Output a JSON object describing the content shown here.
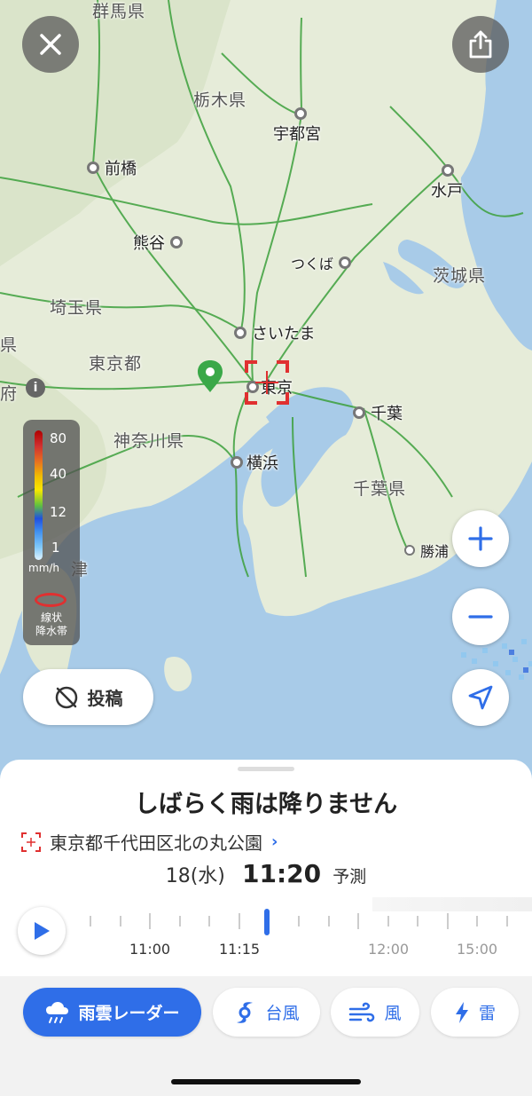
{
  "map": {
    "cities": [
      {
        "name": "宇都宮"
      },
      {
        "name": "前橋"
      },
      {
        "name": "水戸"
      },
      {
        "name": "熊谷"
      },
      {
        "name": "つくば"
      },
      {
        "name": "さいたま"
      },
      {
        "name": "東京"
      },
      {
        "name": "千葉"
      },
      {
        "name": "横浜"
      },
      {
        "name": "勝浦"
      }
    ],
    "prefectures": [
      "群馬県",
      "栃木県",
      "茨城県",
      "埼玉県",
      "東京都",
      "神奈川県",
      "千葉県"
    ],
    "edge_labels": [
      "県",
      "府",
      "津"
    ],
    "info_icon": "info-icon"
  },
  "buttons": {
    "close_icon": "close-icon",
    "share_icon": "share-icon",
    "zoom_in_icon": "plus-icon",
    "zoom_out_icon": "minus-icon",
    "locate_icon": "navigation-arrow-icon"
  },
  "legend": {
    "ticks": [
      "80",
      "40",
      "12",
      "1"
    ],
    "unit": "mm/h",
    "band_label_1": "線状",
    "band_label_2": "降水帯"
  },
  "post_button": {
    "label": "投稿",
    "icon": "no-camera-icon"
  },
  "sheet": {
    "headline": "しばらく雨は降りません",
    "location": "東京都千代田区北の丸公園",
    "date": "18(水)",
    "time": "11:20",
    "forecast_label": "予測",
    "timeline_labels": [
      "11:00",
      "11:15",
      "12:00",
      "15:00"
    ]
  },
  "modes": [
    {
      "label": "雨雲レーダー",
      "icon": "rain-cloud-icon",
      "active": true
    },
    {
      "label": "台風",
      "icon": "typhoon-icon",
      "active": false
    },
    {
      "label": "風",
      "icon": "wind-icon",
      "active": false
    },
    {
      "label": "雷",
      "icon": "lightning-icon",
      "active": false
    }
  ],
  "colors": {
    "accent": "#2f6ee8",
    "land": "#e9eedf",
    "sea": "#a8cbe8",
    "rail": "#3ca03c",
    "marker": "#3aa848",
    "alert": "#e03030"
  }
}
